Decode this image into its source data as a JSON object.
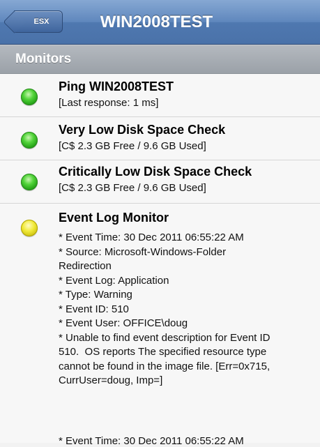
{
  "navbar": {
    "back_label": "ESX",
    "title": "WIN2008TEST"
  },
  "section": {
    "title": "Monitors"
  },
  "monitors": [
    {
      "status": "green",
      "name": "Ping WIN2008TEST",
      "detail": "[Last response: 1 ms]"
    },
    {
      "status": "green",
      "name": "Very Low Disk Space Check",
      "detail": "[C$ 2.3 GB Free / 9.6 GB Used]"
    },
    {
      "status": "green",
      "name": "Critically Low Disk Space Check",
      "detail": "[C$ 2.3 GB Free / 9.6 GB Used]"
    },
    {
      "status": "yellow",
      "name": "Event Log Monitor",
      "lines": [
        "* Event Time: 30 Dec 2011 06:55:22 AM",
        "* Source: Microsoft-Windows-Folder",
        "Redirection",
        "* Event Log: Application",
        "* Type: Warning",
        "* Event ID: 510",
        "* Event User: OFFICE\\doug",
        "* Unable to find event description for Event ID",
        "510.  OS reports The specified resource type",
        "cannot be found in the image file. [Err=0x715,",
        "CurrUser=doug, Imp=]"
      ],
      "cut_line": "* Event Time: 30 Dec 2011 06:55:22 AM"
    }
  ],
  "colors": {
    "status_green": "#1e9a12",
    "status_yellow": "#f1ea3a",
    "navbar_blue": "#5f87bd"
  }
}
